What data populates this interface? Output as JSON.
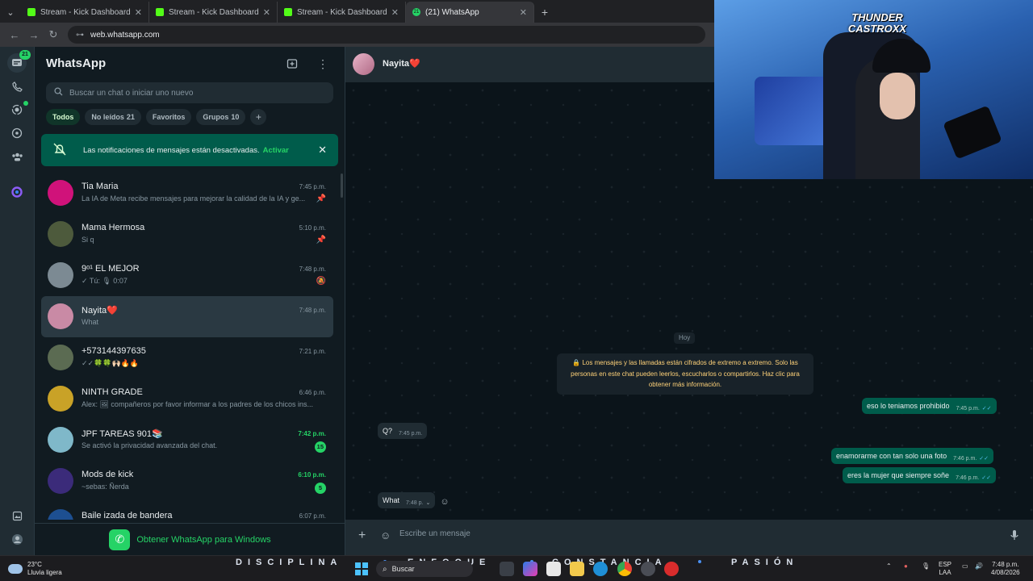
{
  "browser": {
    "tabs": [
      {
        "title": "Stream - Kick Dashboard",
        "active": false
      },
      {
        "title": "Stream - Kick Dashboard",
        "active": false
      },
      {
        "title": "Stream - Kick Dashboard",
        "active": false
      },
      {
        "title": "(21) WhatsApp",
        "active": true,
        "badge": "21"
      }
    ],
    "url": "web.whatsapp.com"
  },
  "rail": {
    "chats_badge": "21",
    "icons": [
      "chats-icon",
      "calls-icon",
      "status-icon",
      "channels-icon",
      "communities-icon",
      "meta-ai-icon",
      "media-icon",
      "settings-icon"
    ]
  },
  "sidebar": {
    "title": "WhatsApp",
    "search_placeholder": "Buscar un chat o iniciar uno nuevo",
    "filters": [
      {
        "label": "Todos",
        "count": "",
        "active": true
      },
      {
        "label": "No leídos",
        "count": "21",
        "active": false
      },
      {
        "label": "Favoritos",
        "count": "",
        "active": false
      },
      {
        "label": "Grupos",
        "count": "10",
        "active": false
      }
    ],
    "notification": {
      "text": "Las notificaciones de mensajes están desactivadas.",
      "action": "Activar"
    },
    "chats": [
      {
        "name": "Tia Maria",
        "time": "7:45 p.m.",
        "preview": "La IA de Meta recibe mensajes para mejorar la calidad de la IA y ge...",
        "meta": "📌",
        "unread": "",
        "avatar_color": "#d0127a"
      },
      {
        "name": "Mama Hermosa",
        "time": "5:10 p.m.",
        "preview": "Si q",
        "meta": "📌",
        "unread": "",
        "avatar_color": "#4d5a3c"
      },
      {
        "name": "9ᵒ¹ EL MEJOR",
        "time": "7:48 p.m.",
        "preview": "✓ Tú: 🎙 0:07",
        "meta": "🔕",
        "unread": "",
        "avatar_color": "#7c8a93"
      },
      {
        "name": "Nayita❤️",
        "time": "7:48 p.m.",
        "preview": "What",
        "meta": "",
        "unread": "",
        "avatar_color": "#c98aa5"
      },
      {
        "name": "+573144397635",
        "time": "7:21 p.m.",
        "preview": "✓✓🍀🍀🙌🏻🔥🔥",
        "meta": "",
        "unread": "",
        "avatar_color": "#5b6b52"
      },
      {
        "name": "NINTH GRADE",
        "time": "6:46 p.m.",
        "preview": "Alex: 🖼 compañeros por favor informar a los padres de los chicos ins...",
        "meta": "",
        "unread": "",
        "avatar_color": "#c9a227"
      },
      {
        "name": "JPF TAREAS 901📚",
        "time": "7:42 p.m.",
        "preview": "Se activó la privacidad avanzada del chat.",
        "meta": "",
        "unread": "15",
        "avatar_color": "#7fb8c9"
      },
      {
        "name": "Mods de kick",
        "time": "6:10 p.m.",
        "preview": "~sebas: Ñerda",
        "meta": "",
        "unread": "5",
        "avatar_color": "#3b2b7a"
      },
      {
        "name": "Baile izada de bandera",
        "time": "6:07 p.m.",
        "preview": "",
        "meta": "",
        "unread": "",
        "avatar_color": "#1d4f91"
      }
    ],
    "get_app": "Obtener WhatsApp para Windows"
  },
  "conversation": {
    "contact": "Nayita❤️",
    "day": "Hoy",
    "system_message": "🔒 Los mensajes y las llamadas están cifrados de extremo a extremo. Solo las personas en este chat pueden leerlos, escucharlos o compartirlos. Haz clic para obtener más información.",
    "messages": [
      {
        "dir": "out",
        "text": "eso lo teniamos prohibido",
        "time": "7:45 p.m.",
        "ticks": "✓✓"
      },
      {
        "dir": "in",
        "text": "Q?",
        "time": "7:45 p.m.",
        "ticks": ""
      },
      {
        "dir": "out",
        "text": "enamorarme con tan solo una foto",
        "time": "7:46 p.m.",
        "ticks": "✓✓"
      },
      {
        "dir": "out",
        "text": "eres la mujer que siempre soñe",
        "time": "7:46 p.m.",
        "ticks": "✓✓"
      },
      {
        "dir": "in",
        "text": "What",
        "time": "7:48 p.",
        "ticks": "⌄"
      }
    ],
    "composer_placeholder": "Escribe un mensaje"
  },
  "overlay": {
    "brand": "THUNDER CASTROXX",
    "words": [
      "DISCIPLINA",
      "ENFOQUE",
      "CONSTANCIA",
      "PASIÓN"
    ]
  },
  "taskbar": {
    "weather_temp": "23°C",
    "weather_desc": "Lluvia ligera",
    "search": "Buscar",
    "lang_top": "ESP",
    "lang_bottom": "LAA",
    "time": "7:48 p.m.",
    "date": "4/08/2026"
  }
}
